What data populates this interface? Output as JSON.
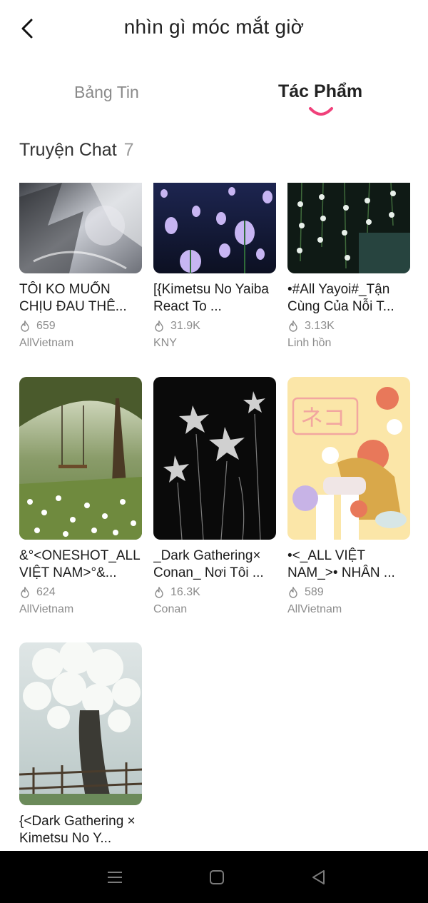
{
  "header": {
    "title": "nhìn gì móc mắt giờ",
    "back_icon": "chevron-left-icon"
  },
  "tabs": [
    {
      "label": "Bảng Tin",
      "active": false
    },
    {
      "label": "Tác Phẩm",
      "active": true
    }
  ],
  "accent_color": "#f0407a",
  "section": {
    "title": "Truyện Chat",
    "count": "7"
  },
  "stories": [
    {
      "title": "TÔI KO MUỐN CHỊU ĐAU THÊ...",
      "views": "659",
      "author": "AllVietnam"
    },
    {
      "title": "[{Kimetsu No Yaiba React To ...",
      "views": "31.9K",
      "author": "KNY"
    },
    {
      "title": "•#All Yayoi#_Tận Cùng Của Nỗi T...",
      "views": "3.13K",
      "author": "Linh hồn"
    },
    {
      "title": "&°<ONESHOT_ALL VIỆT NAM>°&...",
      "views": "624",
      "author": "AllVietnam"
    },
    {
      "title": "_Dark Gathering× Conan_ Nơi Tôi ...",
      "views": "16.3K",
      "author": "Conan"
    },
    {
      "title": "•<_ALL VIỆT NAM_>• NHÂN ...",
      "views": "589",
      "author": "AllVietnam"
    },
    {
      "title": "{<Dark Gathering × Kimetsu No Y...",
      "views": "",
      "author": ""
    }
  ],
  "thumb_katakana": "ネコ",
  "navbar": {
    "buttons": [
      "menu-icon",
      "home-square-icon",
      "back-triangle-icon"
    ]
  }
}
